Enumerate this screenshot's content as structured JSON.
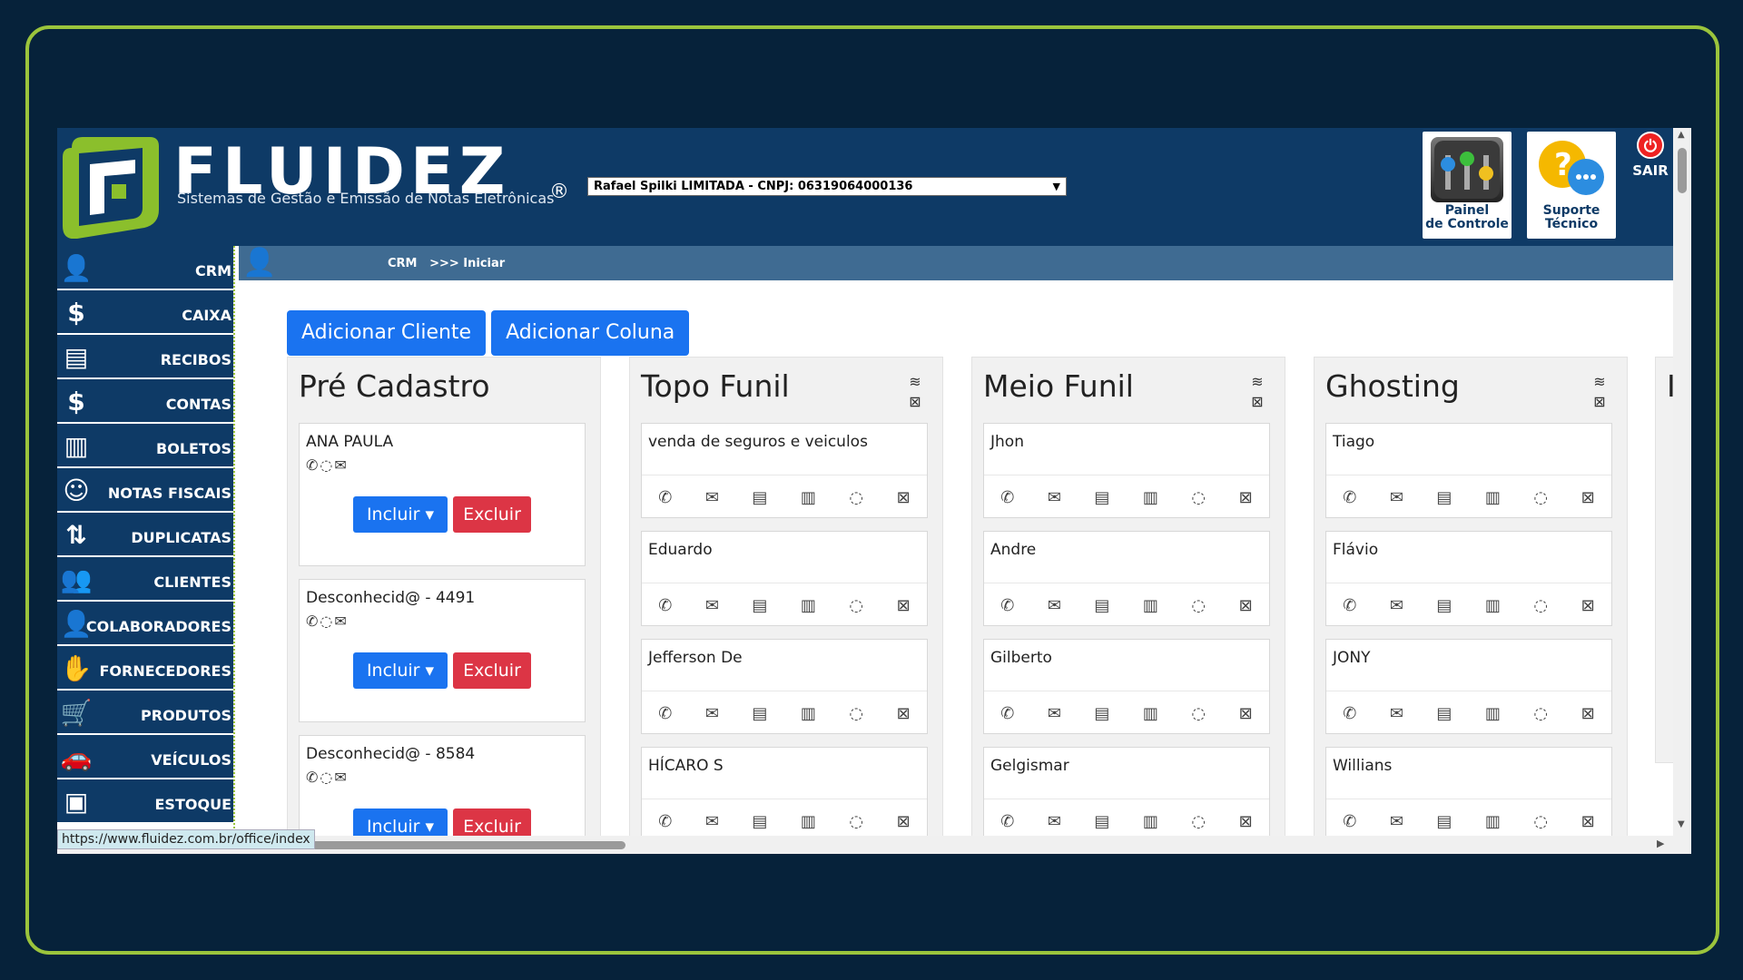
{
  "header": {
    "brand": "FLUIDEZ",
    "tagline": "Sistemas de Gestão e Emissão de Notas Eletrônicas",
    "registered": "®",
    "company_select": "Rafael Spilki LIMITADA - CNPJ: 06319064000136",
    "painel_label_1": "Painel",
    "painel_label_2": "de Controle",
    "suporte_label_1": "Suporte",
    "suporte_label_2": "Técnico",
    "sair_label": "SAIR"
  },
  "sidebar": {
    "items": [
      {
        "label": "CRM",
        "icon": "person-icon"
      },
      {
        "label": "CAIXA",
        "icon": "cash-register-icon"
      },
      {
        "label": "RECIBOS",
        "icon": "receipt-icon"
      },
      {
        "label": "CONTAS",
        "icon": "bill-icon"
      },
      {
        "label": "BOLETOS",
        "icon": "barcode-icon"
      },
      {
        "label": "NOTAS FISCAIS",
        "icon": "invoice-icon"
      },
      {
        "label": "DUPLICATAS",
        "icon": "duplicates-icon"
      },
      {
        "label": "CLIENTES",
        "icon": "clients-icon"
      },
      {
        "label": "COLABORADORES",
        "icon": "collaborators-icon"
      },
      {
        "label": "FORNECEDORES",
        "icon": "suppliers-icon"
      },
      {
        "label": "PRODUTOS",
        "icon": "cart-icon"
      },
      {
        "label": "VEÍCULOS",
        "icon": "vehicle-icon"
      },
      {
        "label": "ESTOQUE",
        "icon": "box-icon"
      }
    ]
  },
  "breadcrumb": {
    "text": "CRM   >>> Iniciar"
  },
  "actions": {
    "add_client": "Adicionar Cliente",
    "add_column": "Adicionar Coluna"
  },
  "columns": [
    {
      "title": "Pré Cadastro",
      "cards": [
        {
          "name": "ANA PAULA"
        },
        {
          "name": "Desconhecid@ - 4491"
        },
        {
          "name": "Desconhecid@ - 8584"
        }
      ],
      "incluir": "Incluir",
      "excluir": "Excluir"
    },
    {
      "title": "Topo Funil",
      "cards": [
        {
          "name": "venda de seguros e veiculos"
        },
        {
          "name": "Eduardo"
        },
        {
          "name": "Jefferson De"
        },
        {
          "name": "HÍCARO S"
        }
      ]
    },
    {
      "title": "Meio Funil",
      "cards": [
        {
          "name": "Jhon"
        },
        {
          "name": "Andre"
        },
        {
          "name": "Gilberto"
        },
        {
          "name": "Gelgismar"
        }
      ]
    },
    {
      "title": "Ghosting",
      "cards": [
        {
          "name": "Tiago"
        },
        {
          "name": "Flávio"
        },
        {
          "name": "JONY"
        },
        {
          "name": "Willians"
        }
      ]
    }
  ],
  "partial_column_title": "I",
  "status_url": "https://www.fluidez.com.br/office/index",
  "colors": {
    "brand_blue": "#0e3a66",
    "accent_green": "#9bc43c",
    "primary": "#1a73f0",
    "danger": "#dc3545"
  }
}
